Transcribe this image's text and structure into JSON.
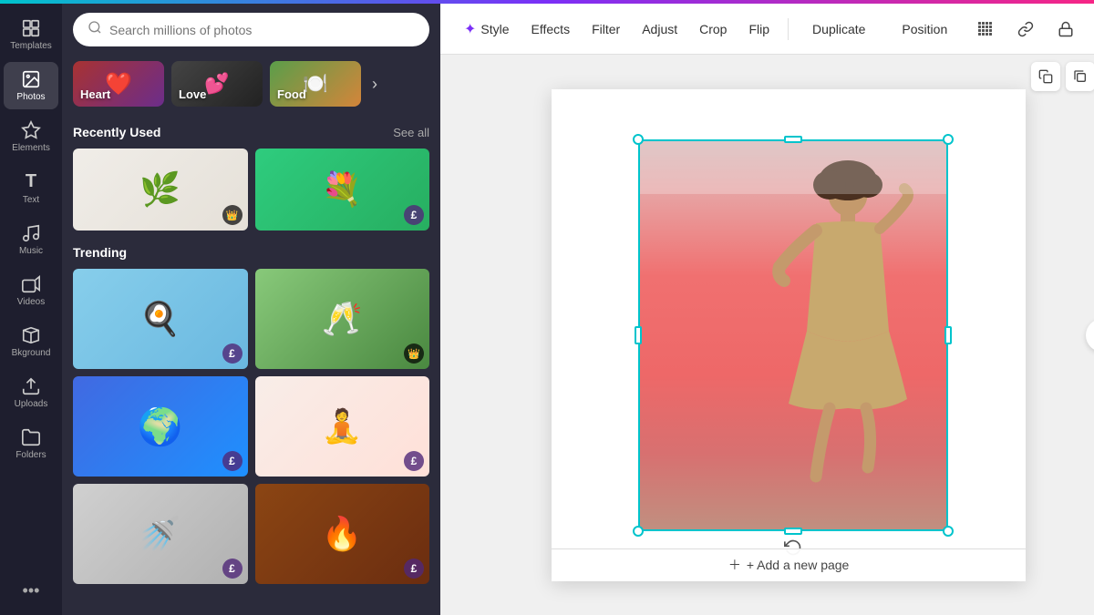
{
  "topBar": {},
  "sidebar": {
    "items": [
      {
        "id": "templates",
        "label": "Templates",
        "icon": "⊞"
      },
      {
        "id": "photos",
        "label": "Photos",
        "icon": "🖼"
      },
      {
        "id": "elements",
        "label": "Elements",
        "icon": "✦"
      },
      {
        "id": "text",
        "label": "Text",
        "icon": "T"
      },
      {
        "id": "music",
        "label": "Music",
        "icon": "♪"
      },
      {
        "id": "videos",
        "label": "Videos",
        "icon": "▶"
      },
      {
        "id": "background",
        "label": "Bkground",
        "icon": "⬜"
      },
      {
        "id": "uploads",
        "label": "Uploads",
        "icon": "↑"
      },
      {
        "id": "folders",
        "label": "Folders",
        "icon": "📁"
      }
    ],
    "more_label": "•••"
  },
  "photosPanel": {
    "search": {
      "placeholder": "Search millions of photos"
    },
    "categories": [
      {
        "id": "heart",
        "label": "Heart"
      },
      {
        "id": "love",
        "label": "Love"
      },
      {
        "id": "food",
        "label": "Food"
      }
    ],
    "recently_used": {
      "title": "Recently Used",
      "see_all": "See all"
    },
    "trending": {
      "title": "Trending"
    }
  },
  "toolbar": {
    "style_label": "Style",
    "effects_label": "Effects",
    "filter_label": "Filter",
    "adjust_label": "Adjust",
    "crop_label": "Crop",
    "flip_label": "Flip",
    "duplicate_label": "Duplicate",
    "position_label": "Position"
  },
  "pageActions": {
    "copy_page": "⧉",
    "add_page": "+",
    "delete_page": "🗑"
  },
  "canvas": {
    "add_page_label": "+ Add a new page"
  }
}
